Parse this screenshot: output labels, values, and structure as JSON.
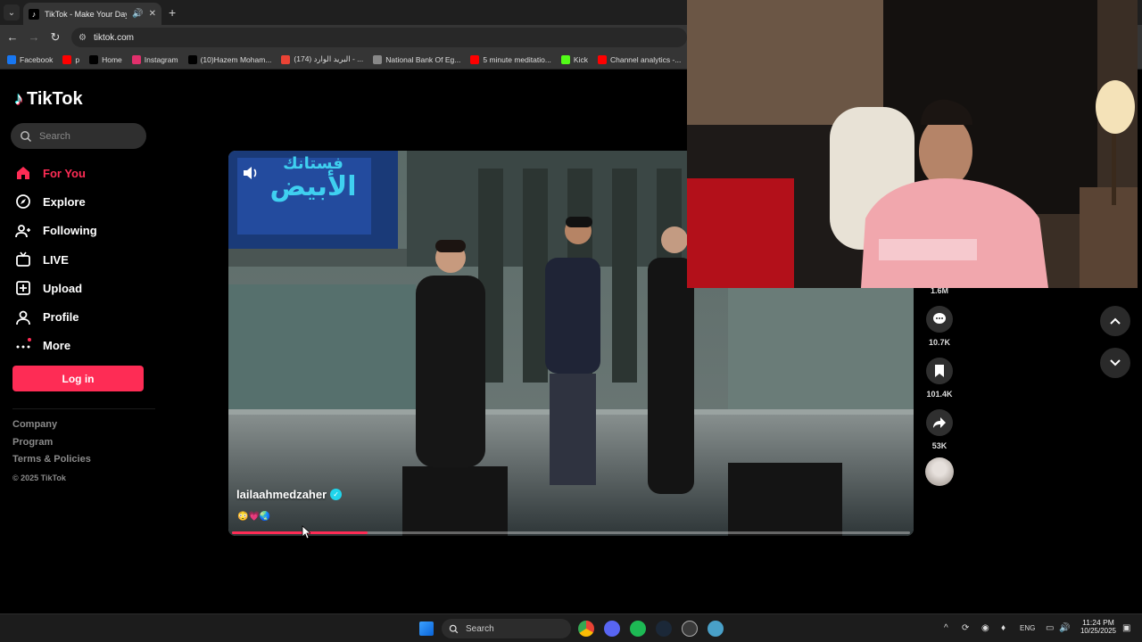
{
  "browser": {
    "tab_title": "TikTok - Make Your Day",
    "url": "tiktok.com",
    "bookmarks": [
      {
        "label": "Facebook",
        "icon": "facebook-icon",
        "color": "#1877f2"
      },
      {
        "label": "p",
        "icon": "youtube-icon",
        "color": "#ff0000"
      },
      {
        "label": "Home",
        "icon": "x-icon",
        "color": "#000000"
      },
      {
        "label": "Instagram",
        "icon": "instagram-icon",
        "color": "#e1306c"
      },
      {
        "label": "(10)Hazem Moham...",
        "icon": "tiktok-icon",
        "color": "#000000"
      },
      {
        "label": "(174) البريد الوارد - ...",
        "icon": "gmail-icon",
        "color": "#ea4335"
      },
      {
        "label": "National Bank Of Eg...",
        "icon": "globe-icon",
        "color": "#888888"
      },
      {
        "label": "5 minute meditatio...",
        "icon": "youtube-icon",
        "color": "#ff0000"
      },
      {
        "label": "Kick",
        "icon": "kick-icon",
        "color": "#53fc18"
      },
      {
        "label": "Channel analytics -...",
        "icon": "youtube-icon",
        "color": "#ff0000"
      }
    ]
  },
  "tiktok": {
    "logo": "TikTok",
    "search_placeholder": "Search",
    "nav": [
      {
        "label": "For You",
        "icon": "home-icon",
        "active": true
      },
      {
        "label": "Explore",
        "icon": "compass-icon",
        "active": false
      },
      {
        "label": "Following",
        "icon": "following-icon",
        "active": false
      },
      {
        "label": "LIVE",
        "icon": "live-icon",
        "active": false
      },
      {
        "label": "Upload",
        "icon": "upload-icon",
        "active": false
      },
      {
        "label": "Profile",
        "icon": "profile-icon",
        "active": false
      },
      {
        "label": "More",
        "icon": "more-icon",
        "active": false
      }
    ],
    "login_label": "Log in",
    "footer_links": [
      "Company",
      "Program",
      "Terms & Policies"
    ],
    "copyright": "© 2025 TikTok",
    "accent_color": "#fe2c55"
  },
  "video": {
    "banner_line1": "فستانك",
    "banner_line2": "الأبيض",
    "author": "lailaahmedzaher",
    "verified": true,
    "caption_emojis": "😳💗🌏",
    "progress": 0.2
  },
  "actions": {
    "likes": "1.6M",
    "comments": "10.7K",
    "saves": "101.4K",
    "shares": "53K"
  },
  "taskbar": {
    "search_label": "Search",
    "language": "ENG",
    "time": "11:24 PM",
    "date": "10/25/2025"
  }
}
